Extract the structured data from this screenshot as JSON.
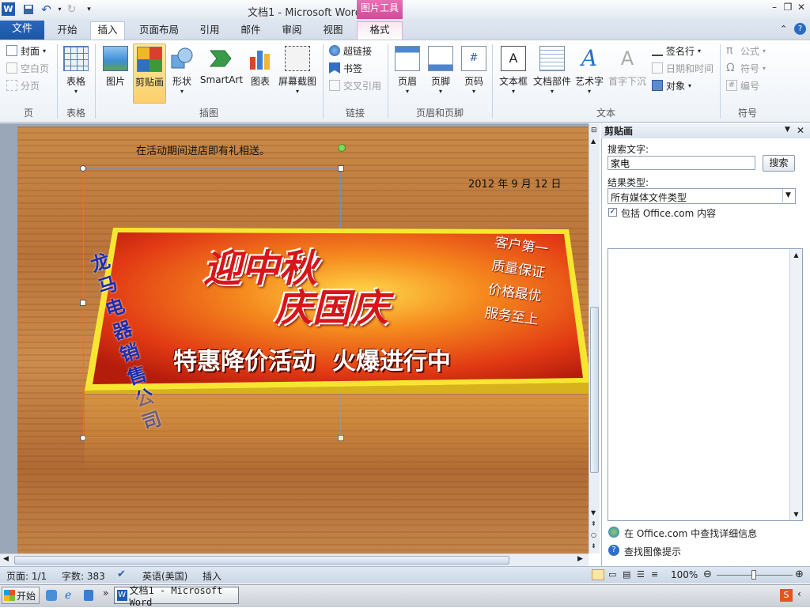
{
  "app": {
    "title": "文档1  -  Microsoft Word",
    "context_tool": "图片工具"
  },
  "tabs": [
    "文件",
    "开始",
    "插入",
    "页面布局",
    "引用",
    "邮件",
    "审阅",
    "视图",
    "格式"
  ],
  "ribbon": {
    "page_group": {
      "cover": "封面",
      "blank": "空白页",
      "break": "分页",
      "label": "页"
    },
    "table_group": {
      "table": "表格",
      "label": "表格"
    },
    "illustrations": {
      "picture": "图片",
      "clipart": "剪贴画",
      "shapes": "形状",
      "smartart": "SmartArt",
      "chart": "图表",
      "screenshot": "屏幕截图",
      "label": "插图"
    },
    "links": {
      "hyperlink": "超链接",
      "bookmark": "书签",
      "crossref": "交叉引用",
      "label": "链接"
    },
    "headerfooter": {
      "header": "页眉",
      "footer": "页脚",
      "pagenum": "页码",
      "label": "页眉和页脚"
    },
    "text": {
      "textbox": "文本框",
      "quickparts": "文档部件",
      "wordart": "艺术字",
      "dropcap": "首字下沉",
      "signature": "签名行",
      "datetime": "日期和时间",
      "object": "对象",
      "label": "文本"
    },
    "symbols": {
      "equation": "公式",
      "symbol": "符号",
      "number": "编号",
      "label": "符号"
    }
  },
  "document": {
    "line1": "在活动期间进店即有礼相送。",
    "date": "2012 年 9 月 12 日",
    "banner": {
      "company": "龙马电器销售公司",
      "headline1": "迎中秋",
      "headline2": "庆国庆",
      "slogans": [
        "客户第一",
        "质量保证",
        "价格最优",
        "服务至上"
      ],
      "promo": "特惠降价活动  火爆进行中"
    }
  },
  "pane": {
    "title": "剪贴画",
    "search_label": "搜索文字:",
    "search_value": "家电",
    "search_button": "搜索",
    "results_label": "结果类型:",
    "results_value": "所有媒体文件类型",
    "include_office": "包括 Office.com 内容",
    "link_office": "在 Office.com 中查找详细信息",
    "link_tips": "查找图像提示"
  },
  "status": {
    "page": "页面: 1/1",
    "words": "字数: 383",
    "language": "英语(美国)",
    "mode": "插入",
    "zoom": "100%"
  },
  "taskbar": {
    "start": "开始",
    "task": "文档1 - Microsoft Word"
  }
}
